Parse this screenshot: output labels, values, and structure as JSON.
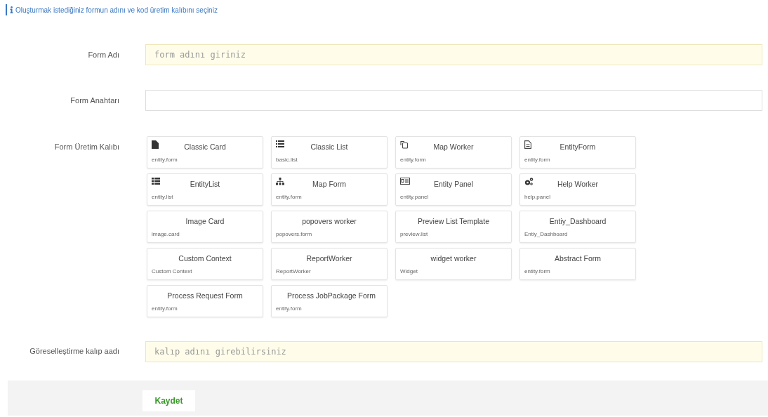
{
  "info_message": "Oluşturmak istediğiniz formun adını ve kod üretim kalıbını seçiniz",
  "form_name": {
    "label": "Form Adı",
    "placeholder": "form adını giriniz"
  },
  "form_key": {
    "label": "Form Anahtarı"
  },
  "templates": {
    "label": "Form Üretim Kalıbı",
    "items": [
      {
        "title": "Classic Card",
        "subtitle": "entity.form"
      },
      {
        "title": "Classic List",
        "subtitle": "basic.list"
      },
      {
        "title": "Map Worker",
        "subtitle": "entity.form"
      },
      {
        "title": "EntityForm",
        "subtitle": "entity.form"
      },
      {
        "title": "EntityList",
        "subtitle": "entity.list"
      },
      {
        "title": "Map Form",
        "subtitle": "entity.form"
      },
      {
        "title": "Entity Panel",
        "subtitle": "entity.panel"
      },
      {
        "title": "Help Worker",
        "subtitle": "help.panel"
      },
      {
        "title": "Image Card",
        "subtitle": "image.card"
      },
      {
        "title": "popovers worker",
        "subtitle": "popovers.form"
      },
      {
        "title": "Preview List Template",
        "subtitle": "preview.list"
      },
      {
        "title": "Entiy_Dashboard",
        "subtitle": "Entiy_Dashboard"
      },
      {
        "title": "Custom Context",
        "subtitle": "Custom Context"
      },
      {
        "title": "ReportWorker",
        "subtitle": "ReportWorker"
      },
      {
        "title": "widget worker",
        "subtitle": "Widget"
      },
      {
        "title": "Abstract Form",
        "subtitle": "entity.form"
      },
      {
        "title": "Process Request Form",
        "subtitle": "entity.form"
      },
      {
        "title": "Process JobPackage Form",
        "subtitle": "entity.form"
      }
    ]
  },
  "visual_template": {
    "label": "Göreselleştirme kalıp aadı",
    "placeholder": "kalıp adını girebilirsiniz"
  },
  "save_button": "Kaydet"
}
